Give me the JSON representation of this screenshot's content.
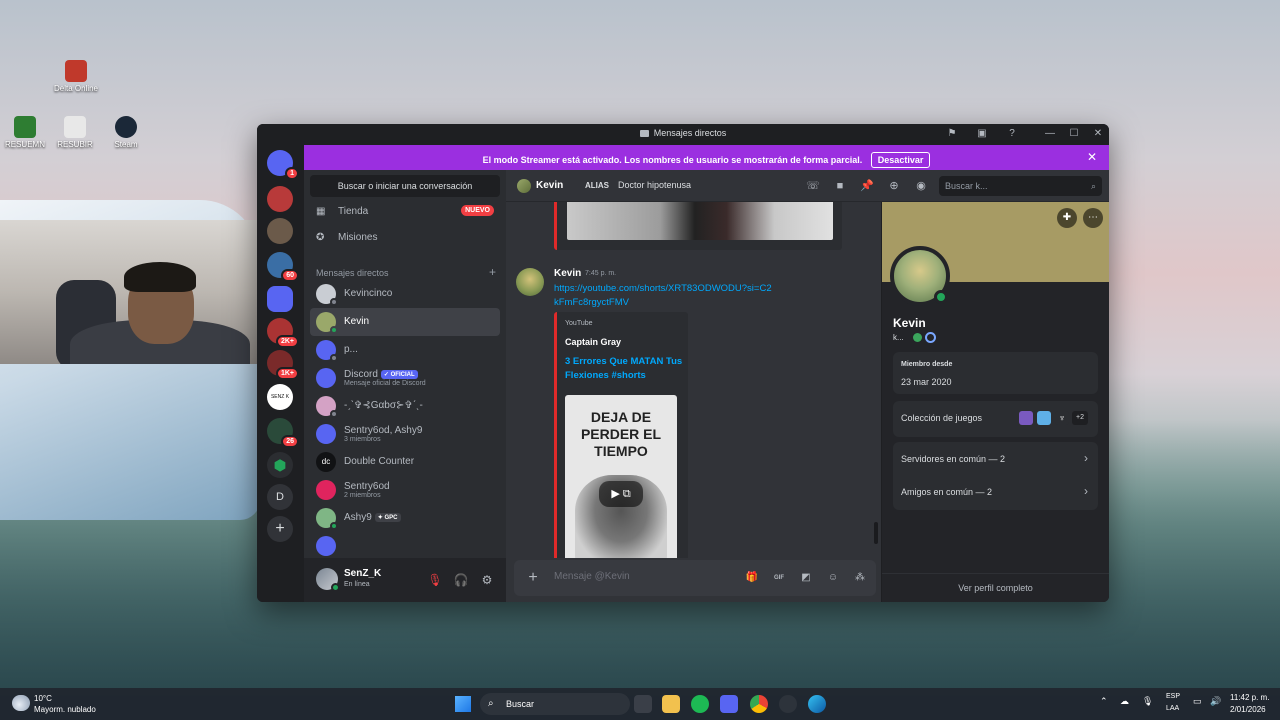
{
  "desktop": {
    "icons": [
      {
        "label": "Delta Online",
        "color": "#c0392b"
      },
      {
        "label": "RESUEMN",
        "color": "#2e7d32"
      },
      {
        "label": "RESUBIR",
        "color": "#e8e8e8"
      },
      {
        "label": "Steam",
        "color": "#1b2838"
      }
    ]
  },
  "window": {
    "title": "Mensajes directos",
    "controls": {
      "minimize": "—",
      "maximize": "☐",
      "close": "✕"
    }
  },
  "streamer_banner": {
    "message": "El modo Streamer está activado. Los nombres de usuario se mostrarán de forma parcial.",
    "button": "Desactivar",
    "close": "✕"
  },
  "guilds": {
    "badges": [
      "1",
      "60",
      "2K+",
      "1K+",
      "26"
    ],
    "server_label": "SENZ K",
    "letter": "D",
    "add": "+"
  },
  "channels": {
    "search_button": "Buscar o iniciar una conversación",
    "items": [
      {
        "label": "Tienda",
        "badge": "NUEVO"
      },
      {
        "label": "Misiones"
      }
    ],
    "dm_header": "Mensajes directos",
    "dm_add": "+",
    "dms": [
      {
        "name": "Kevincinco",
        "color": "#c9cdd3"
      },
      {
        "name": "Kevin",
        "color": "#9aa86a"
      },
      {
        "name": "p...",
        "color": "#5865f2"
      },
      {
        "name": "Discord",
        "tag": "OFICIAL",
        "sub": "Mensaje oficial de Discord",
        "color": "#5865f2"
      },
      {
        "name": "-ˏˋ✞⊰Gαbσ⊱✞ˊˎ-",
        "color": "#d4a2c5"
      },
      {
        "name": "Sentry6od, Ashy9",
        "sub": "3 miembros",
        "color": "#5865f2"
      },
      {
        "name": "Double Counter",
        "color": "#111214"
      },
      {
        "name": "Sentry6od",
        "sub": "2 miembros",
        "color": "#e0245e"
      },
      {
        "name": "Ashy9",
        "tag": "GPC",
        "color": "#7fb685"
      }
    ]
  },
  "user_panel": {
    "name": "SenZ_K",
    "status": "En línea"
  },
  "chat_header": {
    "name": "Kevin",
    "alias_label": "ALIAS",
    "alias_value": "Doctor hipotenusa",
    "search_placeholder": "Buscar k..."
  },
  "message": {
    "author": "Kevin",
    "time": "7:45 p. m.",
    "link": "https://youtube.com/shorts/XRT83ODWODU?si=C2kFmFc8rgyctFMV",
    "embed": {
      "provider": "YouTube",
      "author": "Captain Gray",
      "title": "3 Errores Que MATAN Tus Flexiones #shorts",
      "thumb_text": "DEJA DE PERDER EL TIEMPO"
    }
  },
  "composer": {
    "placeholder": "Mensaje @Kevin",
    "gif": "GIF"
  },
  "profile": {
    "name": "Kevin",
    "subname": "k...",
    "member_since_label": "Miembro desde",
    "member_since": "23 mar 2020",
    "games_label": "Colección de juegos",
    "games_more": "+2",
    "servers_common": "Servidores en común — 2",
    "friends_common": "Amigos en común — 2",
    "full_profile": "Ver perfil completo"
  },
  "taskbar": {
    "weather_temp": "10°C",
    "weather_desc": "Mayorm. nublado",
    "search": "Buscar",
    "lang1": "ESP",
    "lang2": "LAA",
    "time": "11:42 p. m.",
    "date": "2/01/2026"
  }
}
